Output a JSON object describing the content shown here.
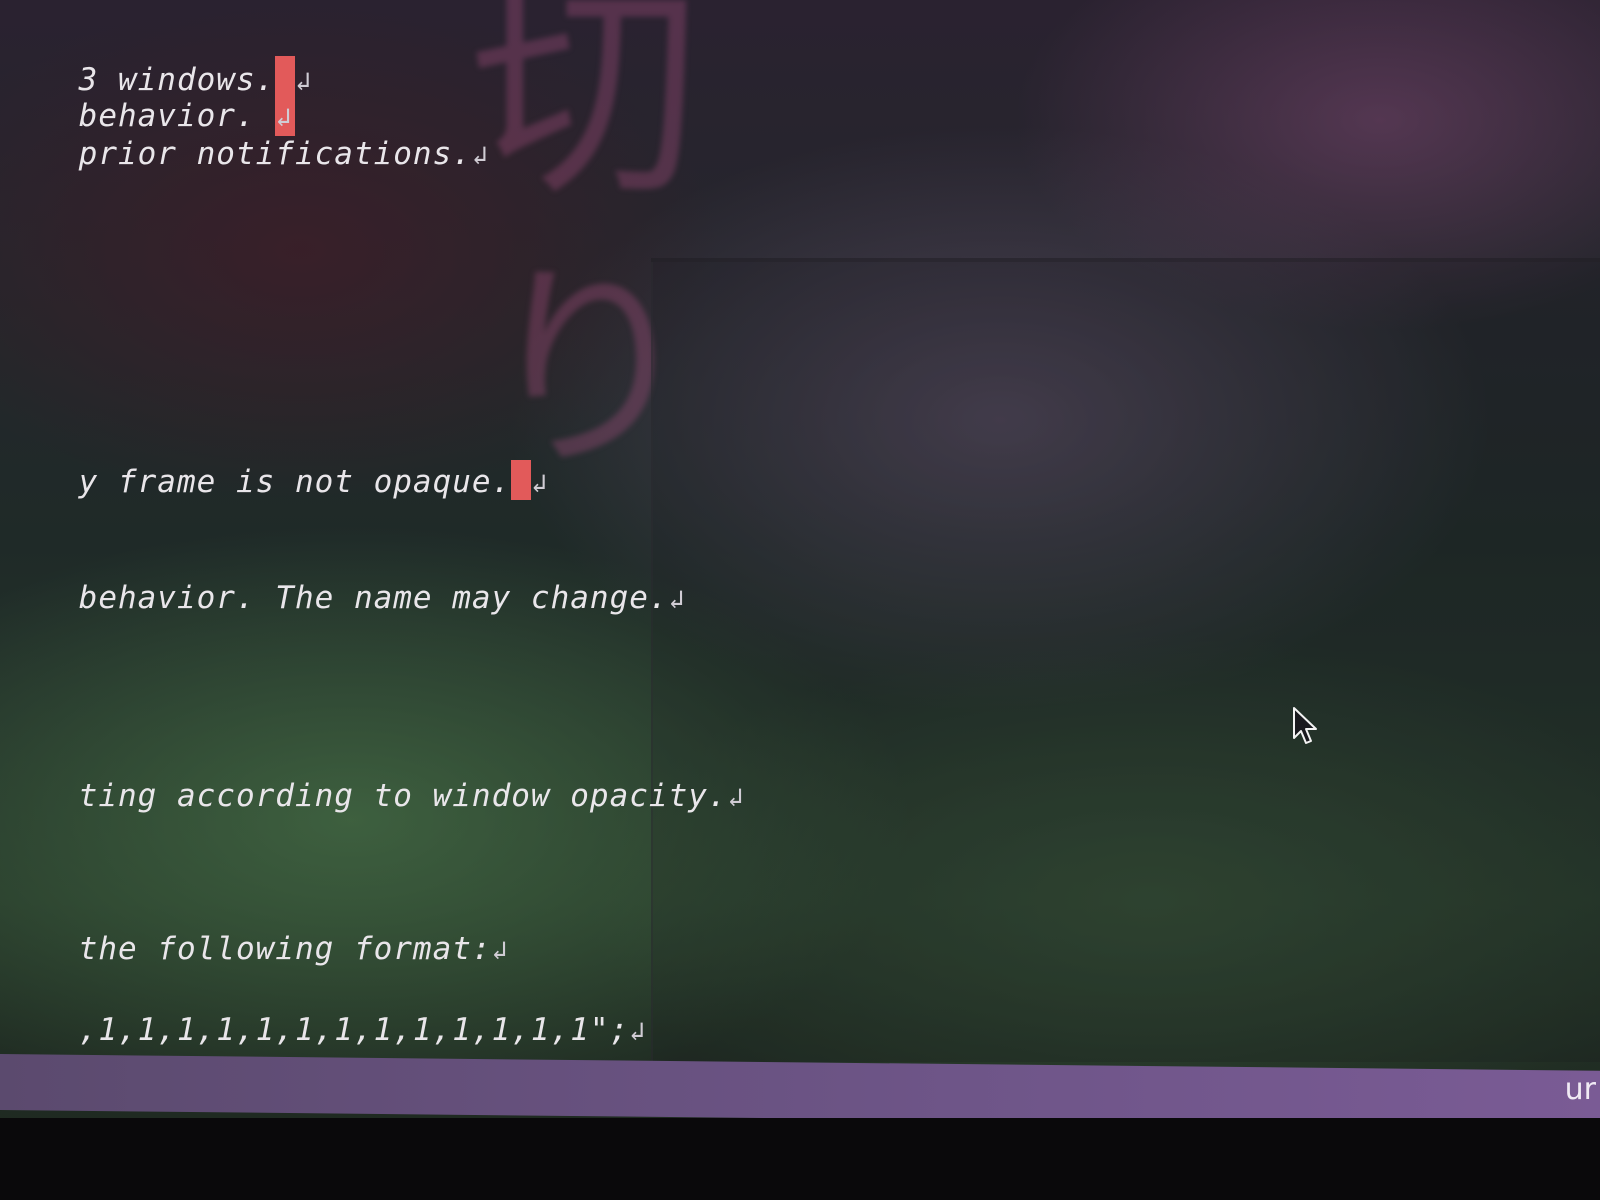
{
  "editor": {
    "lines": [
      "3 windows.",
      "behavior.",
      "prior notifications.",
      "y frame is not opaque.",
      "behavior. The name may change.",
      "ting according to window opacity.",
      "the following format:",
      ",1,1,1,1,1,1,1,1,1,1,1,1,1\";"
    ],
    "newline_glyph": "↲"
  },
  "status_bar": {
    "right_text": "ur"
  },
  "icons": {
    "mouse_pointer": "mouse-pointer-icon"
  },
  "colors": {
    "cursor": "#e25a5a",
    "status_bar": "#6e5588",
    "text": "#e9e6ea"
  }
}
